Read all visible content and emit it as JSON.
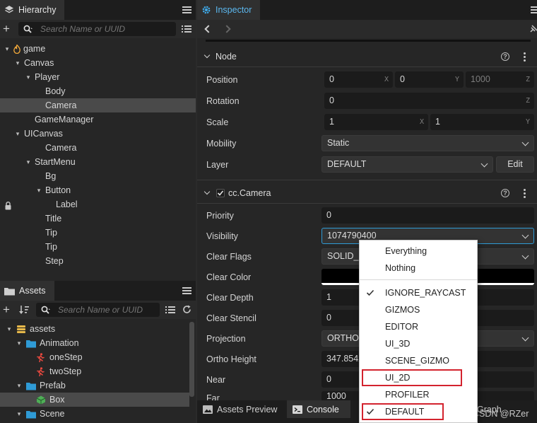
{
  "hierarchy": {
    "tab_label": "Hierarchy",
    "search_placeholder": "Search Name or UUID",
    "items": [
      {
        "label": "game",
        "arrow": "▾",
        "depth": 0,
        "icon": "scene-fire-icon"
      },
      {
        "label": "Canvas",
        "arrow": "▾",
        "depth": 1
      },
      {
        "label": "Player",
        "arrow": "▾",
        "depth": 2
      },
      {
        "label": "Body",
        "arrow": "",
        "depth": 3
      },
      {
        "label": "Camera",
        "arrow": "",
        "depth": 3,
        "selected": true
      },
      {
        "label": "GameManager",
        "arrow": "",
        "depth": 2
      },
      {
        "label": "UICanvas",
        "arrow": "▾",
        "depth": 1
      },
      {
        "label": "Camera",
        "arrow": "",
        "depth": 3
      },
      {
        "label": "StartMenu",
        "arrow": "▾",
        "depth": 2
      },
      {
        "label": "Bg",
        "arrow": "",
        "depth": 3
      },
      {
        "label": "Button",
        "arrow": "▾",
        "depth": 3
      },
      {
        "label": "Label",
        "arrow": "",
        "depth": 4,
        "locked": true
      },
      {
        "label": "Title",
        "arrow": "",
        "depth": 3
      },
      {
        "label": "Tip",
        "arrow": "",
        "depth": 3
      },
      {
        "label": "Tip",
        "arrow": "",
        "depth": 3
      },
      {
        "label": "Step",
        "arrow": "",
        "depth": 3
      }
    ]
  },
  "assets": {
    "tab_label": "Assets",
    "search_placeholder": "Search Name or UUID",
    "items": [
      {
        "label": "assets",
        "arrow": "▾",
        "depth": 0,
        "icon": "db-icon"
      },
      {
        "label": "Animation",
        "arrow": "▾",
        "depth": 1,
        "icon": "folder-icon"
      },
      {
        "label": "oneStep",
        "arrow": "",
        "depth": 2,
        "icon": "anim-icon"
      },
      {
        "label": "twoStep",
        "arrow": "",
        "depth": 2,
        "icon": "anim-icon"
      },
      {
        "label": "Prefab",
        "arrow": "▾",
        "depth": 1,
        "icon": "folder-icon"
      },
      {
        "label": "Box",
        "arrow": "",
        "depth": 2,
        "icon": "prefab-icon",
        "selected": true
      },
      {
        "label": "Scene",
        "arrow": "▾",
        "depth": 1,
        "icon": "folder-icon"
      }
    ]
  },
  "inspector": {
    "tab_label": "Inspector",
    "node": {
      "header": "Node",
      "position_label": "Position",
      "position": {
        "x": "0",
        "y": "0",
        "z": "1000",
        "x_axis": "X",
        "y_axis": "Y",
        "z_axis": "Z"
      },
      "rotation_label": "Rotation",
      "rotation": {
        "value": "0",
        "axis": "Z"
      },
      "scale_label": "Scale",
      "scale": {
        "x": "1",
        "y": "1",
        "x_axis": "X",
        "y_axis": "Y"
      },
      "mobility_label": "Mobility",
      "mobility_value": "Static",
      "layer_label": "Layer",
      "layer_value": "DEFAULT",
      "edit_label": "Edit"
    },
    "camera": {
      "header": "cc.Camera",
      "priority_label": "Priority",
      "priority_value": "0",
      "visibility_label": "Visibility",
      "visibility_value": "1074790400",
      "clear_flags_label": "Clear Flags",
      "clear_flags_value": "SOLID_C",
      "clear_color_label": "Clear Color",
      "clear_color_value": "#000000",
      "clear_depth_label": "Clear Depth",
      "clear_depth_value": "1",
      "clear_stencil_label": "Clear Stencil",
      "clear_stencil_value": "0",
      "projection_label": "Projection",
      "projection_value": "ORTHO",
      "ortho_height_label": "Ortho Height",
      "ortho_height_value": "347.8542",
      "near_label": "Near",
      "near_value": "0",
      "far_label": "Far",
      "far_value": "1000"
    }
  },
  "visibility_menu": {
    "items": [
      {
        "label": "Everything",
        "checked": false
      },
      {
        "label": "Nothing",
        "checked": false
      },
      {
        "label": "IGNORE_RAYCAST",
        "checked": true
      },
      {
        "label": "GIZMOS",
        "checked": false
      },
      {
        "label": "EDITOR",
        "checked": false
      },
      {
        "label": "UI_3D",
        "checked": false
      },
      {
        "label": "SCENE_GIZMO",
        "checked": false
      },
      {
        "label": "UI_2D",
        "checked": false,
        "highlight": true
      },
      {
        "label": "PROFILER",
        "checked": false
      },
      {
        "label": "DEFAULT",
        "checked": true,
        "highlight": true
      }
    ]
  },
  "bottom_tabs": {
    "assets_preview": "Assets Preview",
    "console": "Console",
    "graph": "Graph"
  },
  "watermark": "CSDN @RZer",
  "colors": {
    "accent": "#2f9bd6",
    "highlight_box": "#d3232e"
  }
}
